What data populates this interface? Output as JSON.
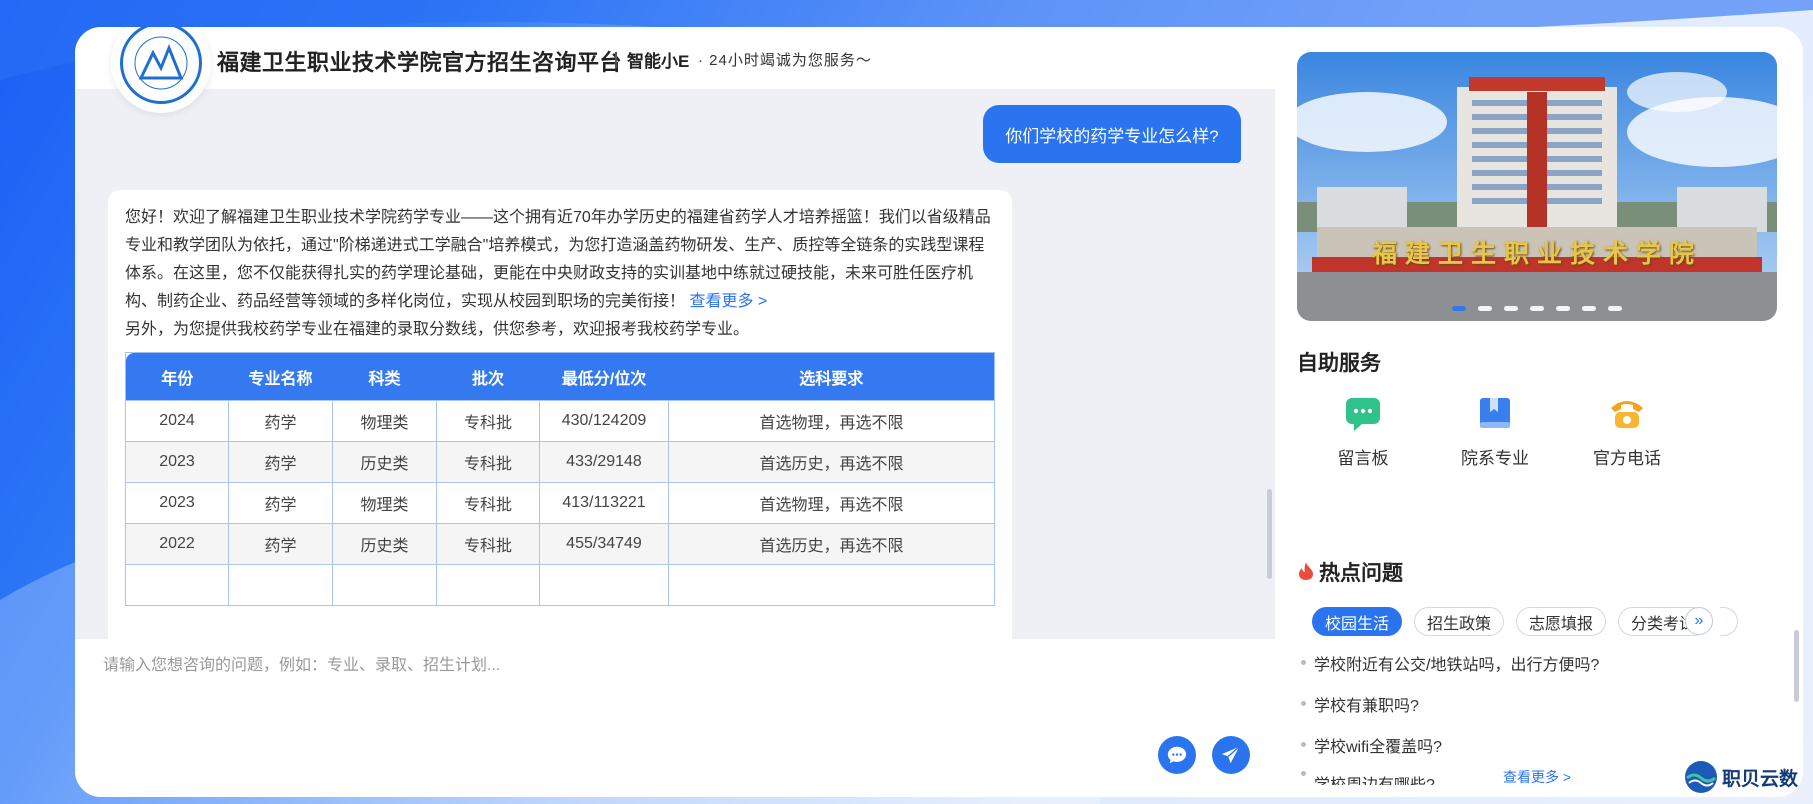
{
  "header": {
    "title": "福建卫生职业技术学院官方招生咨询平台",
    "brand": "智能小E",
    "slogan": "· 24小时竭诚为您服务～"
  },
  "chat": {
    "user_message": "你们学校的药学专业怎么样?",
    "bot_reply_p1": "您好！欢迎了解福建卫生职业技术学院药学专业——这个拥有近70年办学历史的福建省药学人才培养摇篮！我们以省级精品专业和教学团队为依托，通过\"阶梯递进式工学融合\"培养模式，为您打造涵盖药物研发、生产、质控等全链条的实践型课程体系。在这里，您不仅能获得扎实的药学理论基础，更能在中央财政支持的实训基地中练就过硬技能，未来可胜任医疗机构、制药企业、药品经营等领域的多样化岗位，实现从校园到职场的完美衔接！",
    "more_link": "查看更多 >",
    "bot_reply_p2": "另外，为您提供我校药学专业在福建的录取分数线，供您参考，欢迎报考我校药学专业。",
    "table": {
      "headers": [
        "年份",
        "专业名称",
        "科类",
        "批次",
        "最低分/位次",
        "选科要求"
      ],
      "rows": [
        [
          "2024",
          "药学",
          "物理类",
          "专科批",
          "430/124209",
          "首选物理，再选不限"
        ],
        [
          "2023",
          "药学",
          "历史类",
          "专科批",
          "433/29148",
          "首选历史，再选不限"
        ],
        [
          "2023",
          "药学",
          "物理类",
          "专科批",
          "413/113221",
          "首选物理，再选不限"
        ],
        [
          "2022",
          "药学",
          "历史类",
          "专科批",
          "455/34749",
          "首选历史，再选不限"
        ]
      ]
    }
  },
  "input": {
    "placeholder": "请输入您想咨询的问题，例如：专业、录取、招生计划..."
  },
  "right": {
    "service_title": "自助服务",
    "services": [
      {
        "label": "留言板",
        "icon": "message-board-icon"
      },
      {
        "label": "院系专业",
        "icon": "book-icon"
      },
      {
        "label": "官方电话",
        "icon": "phone-icon"
      }
    ],
    "hot_title": "热点问题",
    "tabs": [
      "校园生活",
      "招生政策",
      "志愿填报",
      "分类考试"
    ],
    "questions": [
      "学校附近有公交/地铁站吗，出行方便吗?",
      "学校有兼职吗?",
      "学校wifi全覆盖吗?",
      "学校周边有哪些?"
    ],
    "see_more": "查看更多 >",
    "banner_sign": "福建卫生职业技术学院"
  },
  "footer": {
    "brand": "职贝云数"
  },
  "colors": {
    "primary": "#2b74f0",
    "table_header": "#3479f0"
  }
}
